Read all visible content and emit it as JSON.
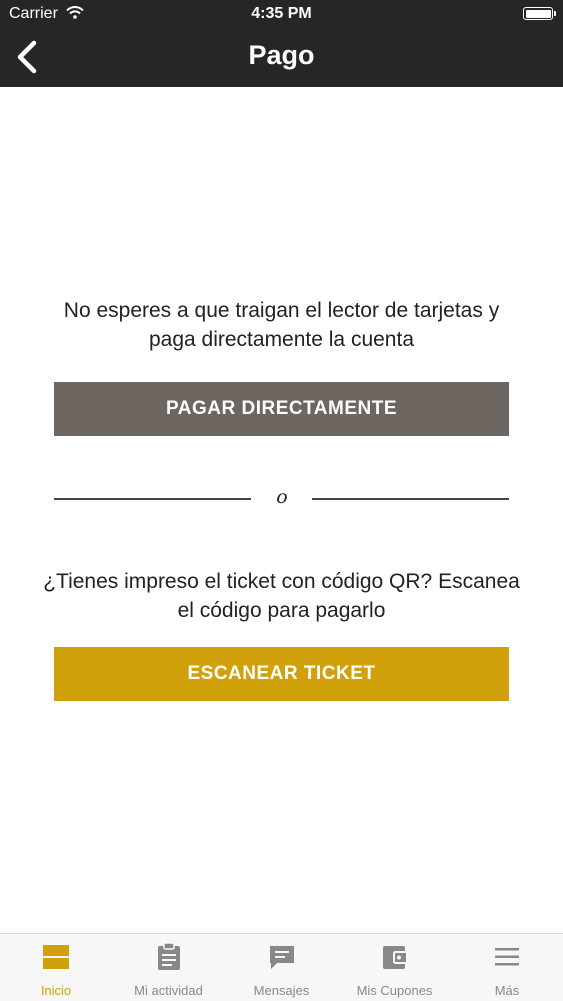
{
  "status_bar": {
    "carrier": "Carrier",
    "time": "4:35 PM"
  },
  "header": {
    "title": "Pago"
  },
  "main": {
    "direct_text_line1": "No esperes a que traigan el lector de tarjetas y",
    "direct_text_line2": "paga directamente la cuenta",
    "direct_button": "PAGAR DIRECTAMENTE",
    "divider_text": "o",
    "scan_text_line1": "¿Tienes impreso el ticket con código QR? Escanea",
    "scan_text_line2": "el código para pagarlo",
    "scan_button": "ESCANEAR TICKET"
  },
  "tabbar": {
    "items": [
      {
        "label": "Inicio",
        "icon": "home-icon",
        "active": true
      },
      {
        "label": "Mi actividad",
        "icon": "clipboard-icon"
      },
      {
        "label": "Mensajes",
        "icon": "message-icon"
      },
      {
        "label": "Mis Cupones",
        "icon": "wallet-icon"
      },
      {
        "label": "Más",
        "icon": "menu-icon"
      }
    ]
  },
  "colors": {
    "header": "#262626",
    "accent": "#d0a10a",
    "pay_button": "#6e6660"
  }
}
